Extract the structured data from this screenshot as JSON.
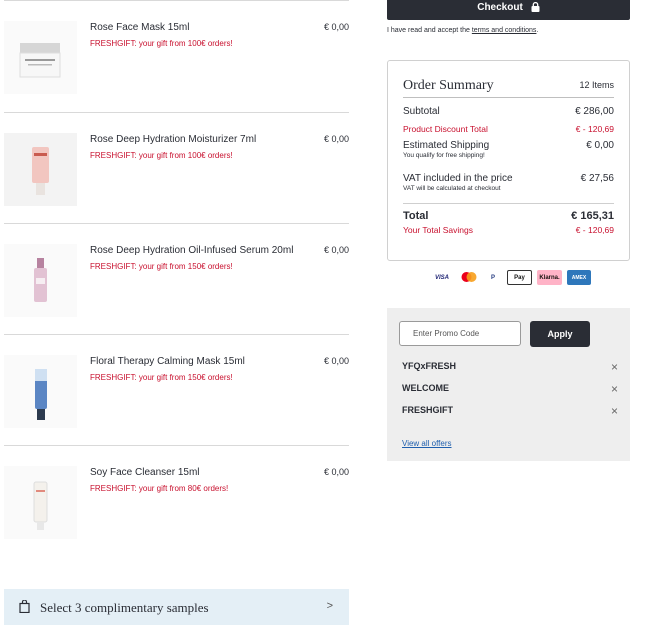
{
  "items": [
    {
      "name": "Rose Face Mask 15ml",
      "gift": "FRESHGIFT: your gift from 100€ orders!",
      "price": "€ 0,00"
    },
    {
      "name": "Rose Deep Hydration Moisturizer 7ml",
      "gift": "FRESHGIFT: your gift from 100€ orders!",
      "price": "€ 0,00"
    },
    {
      "name": "Rose Deep Hydration Oil-Infused Serum 20ml",
      "gift": "FRESHGIFT: your gift from 150€ orders!",
      "price": "€ 0,00"
    },
    {
      "name": "Floral Therapy Calming Mask 15ml",
      "gift": "FRESHGIFT: your gift from 150€ orders!",
      "price": "€ 0,00"
    },
    {
      "name": "Soy Face Cleanser 15ml",
      "gift": "FRESHGIFT: your gift from 80€ orders!",
      "price": "€ 0,00"
    }
  ],
  "samples": {
    "label": "Select 3 complimentary samples"
  },
  "checkout": {
    "label": "Checkout"
  },
  "terms": {
    "prefix": "I have read and accept the ",
    "link": "terms and conditions",
    "suffix": "."
  },
  "summary": {
    "title": "Order Summary",
    "count": "12 Items",
    "subtotal_label": "Subtotal",
    "subtotal_value": "€ 286,00",
    "discount_label": "Product Discount Total",
    "discount_value": "€ - 120,69",
    "shipping_label": "Estimated Shipping",
    "shipping_value": "€ 0,00",
    "shipping_note": "You qualify for free shipping!",
    "vat_label": "VAT included in the price",
    "vat_value": "€ 27,56",
    "vat_note": "VAT will be calculated at checkout",
    "total_label": "Total",
    "total_value": "€ 165,31",
    "savings_label": "Your Total Savings",
    "savings_value": "€ - 120,69"
  },
  "payments": {
    "visa": "VISA",
    "paypal": "P",
    "applepay": "Pay",
    "klarna": "Klarna.",
    "amex": "AMEX"
  },
  "promo": {
    "placeholder": "Enter Promo Code",
    "apply": "Apply",
    "codes": [
      "YFQxFRESH",
      "WELCOME",
      "FRESHGIFT"
    ],
    "offers_link": "View all offers"
  },
  "colors": {
    "dark": "#2a2d35",
    "red": "#c8102e",
    "samples_bg": "#e4eff6",
    "promo_bg": "#eeeeee",
    "link": "#1f5fae"
  }
}
